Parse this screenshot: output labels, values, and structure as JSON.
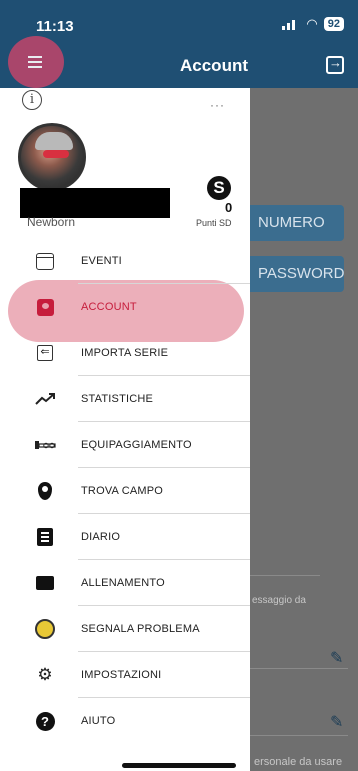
{
  "status_bar": {
    "time": "11:13",
    "battery": "92"
  },
  "app_bar": {
    "title": "Account"
  },
  "background": {
    "button_numero": "NUMERO",
    "button_password": "PASSWORD",
    "text_1": "essaggio da",
    "text_2": "ersonale da usare"
  },
  "drawer": {
    "user_name": "Newborn",
    "points_value": "0",
    "points_label": "Punti SD",
    "menu": [
      {
        "label": "EVENTI",
        "icon": "calendar-icon"
      },
      {
        "label": "ACCOUNT",
        "icon": "account-badge-icon",
        "active": true
      },
      {
        "label": "IMPORTA SERIE",
        "icon": "import-icon"
      },
      {
        "label": "STATISTICHE",
        "icon": "trending-up-icon"
      },
      {
        "label": "EQUIPAGGIAMENTO",
        "icon": "equipment-icon"
      },
      {
        "label": "TROVA CAMPO",
        "icon": "location-pin-icon"
      },
      {
        "label": "DIARIO",
        "icon": "diary-icon"
      },
      {
        "label": "ALLENAMENTO",
        "icon": "training-icon"
      },
      {
        "label": "SEGNALA PROBLEMA",
        "icon": "report-problem-icon"
      },
      {
        "label": "IMPOSTAZIONI",
        "icon": "gear-icon"
      },
      {
        "label": "AIUTO",
        "icon": "help-icon"
      }
    ]
  },
  "colors": {
    "app_bar": "#1f4f73",
    "accent": "#c61d3c",
    "highlight": "#e9a1ae"
  }
}
